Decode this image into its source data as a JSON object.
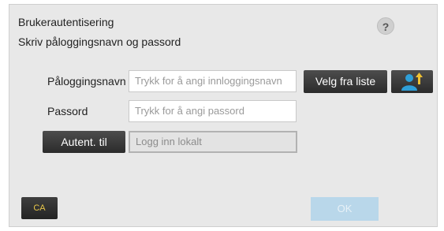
{
  "dialog": {
    "title": "Brukerautentisering",
    "subtitle": "Skriv påloggingsnavn og passord",
    "help_label": "?"
  },
  "form": {
    "username_label": "Påloggingsnavn",
    "username_placeholder": "Trykk for å angi innloggingsnavn",
    "password_label": "Passord",
    "password_placeholder": "Trykk for å angi passord",
    "select_list_label": "Velg fra liste",
    "user_list_icon": "user-add-icon",
    "auth_to_label": "Autent. til",
    "auth_to_value": "Logg inn lokalt"
  },
  "footer": {
    "ca_label": "CA",
    "ok_label": "OK"
  },
  "colors": {
    "icon_blue": "#2e9fd8",
    "icon_arrow": "#f1c232",
    "ok_disabled": "#b9d7ea",
    "ca_text": "#e9c74a"
  }
}
